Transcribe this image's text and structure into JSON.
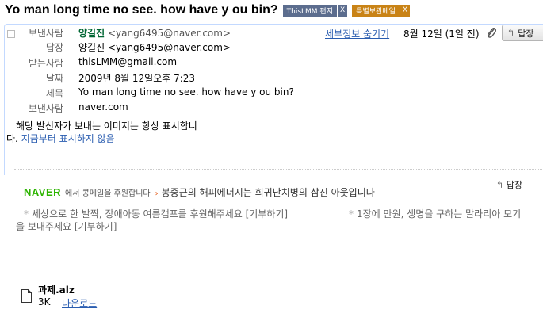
{
  "subject": "Yo man long time no see. how have y ou bin?",
  "labels": [
    {
      "text": "ThisLMM 편지",
      "close": "X",
      "color": "#5c6d8e"
    },
    {
      "text": "특별보관메일",
      "close": "X",
      "color": "#c98316"
    }
  ],
  "header": {
    "from_label": "보낸사람",
    "from_name": "양길진",
    "from_email": "<yang6495@naver.com>",
    "reply_to_label": "답장",
    "reply_to_value": "양길진 <yang6495@naver.com>",
    "to_label": "받는사람",
    "to_value": "thisLMM@gmail.com",
    "date_label": "날짜",
    "date_value": "2009년 8월 12일오후 7:23",
    "subject_label": "제목",
    "subject_value": "Yo man long time no see. how have y ou bin?",
    "mailed_by_label": "보낸사람",
    "mailed_by_value": "naver.com",
    "hide_details_link": "세부정보 숨기기",
    "date_short": "8월 12일 (1일 전)",
    "reply_button": "답장"
  },
  "image_warning": {
    "line1": "해당 발신자가 보내는 이미지는 항상 표시합니",
    "line2_prefix": "다.",
    "line2_link": "지금부터 표시하지 않음"
  },
  "naver": {
    "logo": "NAVER",
    "sub": "에서 콩메일을 후원합니다",
    "arrow": "›",
    "campaign": "봉중근의 해피에너지는 희귀난치병의 삼진 아웃입니다"
  },
  "donations": {
    "bullet": "*",
    "item1": "세상으로 한 발짝, 장애아동 여름캠프를 후원해주세요  [기부하기]",
    "item2": "1장에 만원, 생명을 구하는 말라리아 모기",
    "item3": "을 보내주세요  [기부하기]"
  },
  "small_reply": "답장",
  "attachment": {
    "name": "과제.alz",
    "size": "3K",
    "download": "다운로드"
  },
  "icons": {
    "clip": "paperclip-icon",
    "reply": "reply-arrow-icon",
    "file": "file-icon"
  }
}
